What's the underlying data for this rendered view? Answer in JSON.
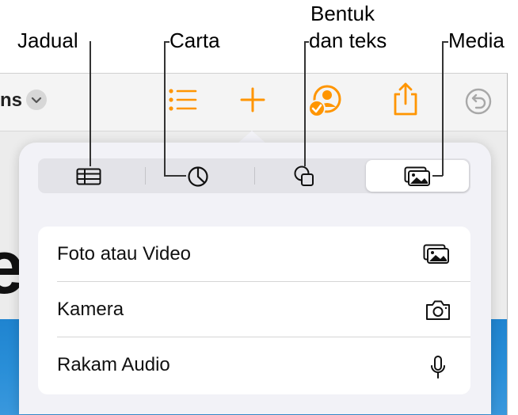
{
  "callouts": {
    "table": "Jadual",
    "chart": "Carta",
    "shape_line1": "Bentuk",
    "shape_line2": "dan teks",
    "media": "Media"
  },
  "toolbar": {
    "doc_name": "ns"
  },
  "document": {
    "visible_text": "e"
  },
  "media_menu": {
    "items": [
      {
        "label": "Foto atau Video",
        "icon": "photo-library-icon"
      },
      {
        "label": "Kamera",
        "icon": "camera-icon"
      },
      {
        "label": "Rakam Audio",
        "icon": "microphone-icon"
      }
    ]
  },
  "colors": {
    "accent": "#ff9500",
    "doc_blue": "#2a8fd8",
    "popover_bg": "#f2f2f7"
  }
}
